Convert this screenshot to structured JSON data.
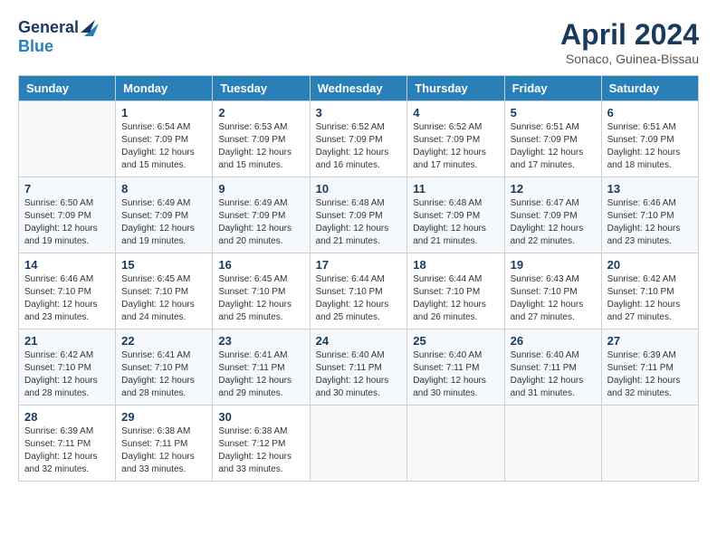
{
  "header": {
    "logo_general": "General",
    "logo_blue": "Blue",
    "month_title": "April 2024",
    "location": "Sonaco, Guinea-Bissau"
  },
  "days_of_week": [
    "Sunday",
    "Monday",
    "Tuesday",
    "Wednesday",
    "Thursday",
    "Friday",
    "Saturday"
  ],
  "weeks": [
    [
      {
        "day": "",
        "info": ""
      },
      {
        "day": "1",
        "info": "Sunrise: 6:54 AM\nSunset: 7:09 PM\nDaylight: 12 hours\nand 15 minutes."
      },
      {
        "day": "2",
        "info": "Sunrise: 6:53 AM\nSunset: 7:09 PM\nDaylight: 12 hours\nand 15 minutes."
      },
      {
        "day": "3",
        "info": "Sunrise: 6:52 AM\nSunset: 7:09 PM\nDaylight: 12 hours\nand 16 minutes."
      },
      {
        "day": "4",
        "info": "Sunrise: 6:52 AM\nSunset: 7:09 PM\nDaylight: 12 hours\nand 17 minutes."
      },
      {
        "day": "5",
        "info": "Sunrise: 6:51 AM\nSunset: 7:09 PM\nDaylight: 12 hours\nand 17 minutes."
      },
      {
        "day": "6",
        "info": "Sunrise: 6:51 AM\nSunset: 7:09 PM\nDaylight: 12 hours\nand 18 minutes."
      }
    ],
    [
      {
        "day": "7",
        "info": "Sunrise: 6:50 AM\nSunset: 7:09 PM\nDaylight: 12 hours\nand 19 minutes."
      },
      {
        "day": "8",
        "info": "Sunrise: 6:49 AM\nSunset: 7:09 PM\nDaylight: 12 hours\nand 19 minutes."
      },
      {
        "day": "9",
        "info": "Sunrise: 6:49 AM\nSunset: 7:09 PM\nDaylight: 12 hours\nand 20 minutes."
      },
      {
        "day": "10",
        "info": "Sunrise: 6:48 AM\nSunset: 7:09 PM\nDaylight: 12 hours\nand 21 minutes."
      },
      {
        "day": "11",
        "info": "Sunrise: 6:48 AM\nSunset: 7:09 PM\nDaylight: 12 hours\nand 21 minutes."
      },
      {
        "day": "12",
        "info": "Sunrise: 6:47 AM\nSunset: 7:09 PM\nDaylight: 12 hours\nand 22 minutes."
      },
      {
        "day": "13",
        "info": "Sunrise: 6:46 AM\nSunset: 7:10 PM\nDaylight: 12 hours\nand 23 minutes."
      }
    ],
    [
      {
        "day": "14",
        "info": "Sunrise: 6:46 AM\nSunset: 7:10 PM\nDaylight: 12 hours\nand 23 minutes."
      },
      {
        "day": "15",
        "info": "Sunrise: 6:45 AM\nSunset: 7:10 PM\nDaylight: 12 hours\nand 24 minutes."
      },
      {
        "day": "16",
        "info": "Sunrise: 6:45 AM\nSunset: 7:10 PM\nDaylight: 12 hours\nand 25 minutes."
      },
      {
        "day": "17",
        "info": "Sunrise: 6:44 AM\nSunset: 7:10 PM\nDaylight: 12 hours\nand 25 minutes."
      },
      {
        "day": "18",
        "info": "Sunrise: 6:44 AM\nSunset: 7:10 PM\nDaylight: 12 hours\nand 26 minutes."
      },
      {
        "day": "19",
        "info": "Sunrise: 6:43 AM\nSunset: 7:10 PM\nDaylight: 12 hours\nand 27 minutes."
      },
      {
        "day": "20",
        "info": "Sunrise: 6:42 AM\nSunset: 7:10 PM\nDaylight: 12 hours\nand 27 minutes."
      }
    ],
    [
      {
        "day": "21",
        "info": "Sunrise: 6:42 AM\nSunset: 7:10 PM\nDaylight: 12 hours\nand 28 minutes."
      },
      {
        "day": "22",
        "info": "Sunrise: 6:41 AM\nSunset: 7:10 PM\nDaylight: 12 hours\nand 28 minutes."
      },
      {
        "day": "23",
        "info": "Sunrise: 6:41 AM\nSunset: 7:11 PM\nDaylight: 12 hours\nand 29 minutes."
      },
      {
        "day": "24",
        "info": "Sunrise: 6:40 AM\nSunset: 7:11 PM\nDaylight: 12 hours\nand 30 minutes."
      },
      {
        "day": "25",
        "info": "Sunrise: 6:40 AM\nSunset: 7:11 PM\nDaylight: 12 hours\nand 30 minutes."
      },
      {
        "day": "26",
        "info": "Sunrise: 6:40 AM\nSunset: 7:11 PM\nDaylight: 12 hours\nand 31 minutes."
      },
      {
        "day": "27",
        "info": "Sunrise: 6:39 AM\nSunset: 7:11 PM\nDaylight: 12 hours\nand 32 minutes."
      }
    ],
    [
      {
        "day": "28",
        "info": "Sunrise: 6:39 AM\nSunset: 7:11 PM\nDaylight: 12 hours\nand 32 minutes."
      },
      {
        "day": "29",
        "info": "Sunrise: 6:38 AM\nSunset: 7:11 PM\nDaylight: 12 hours\nand 33 minutes."
      },
      {
        "day": "30",
        "info": "Sunrise: 6:38 AM\nSunset: 7:12 PM\nDaylight: 12 hours\nand 33 minutes."
      },
      {
        "day": "",
        "info": ""
      },
      {
        "day": "",
        "info": ""
      },
      {
        "day": "",
        "info": ""
      },
      {
        "day": "",
        "info": ""
      }
    ]
  ]
}
